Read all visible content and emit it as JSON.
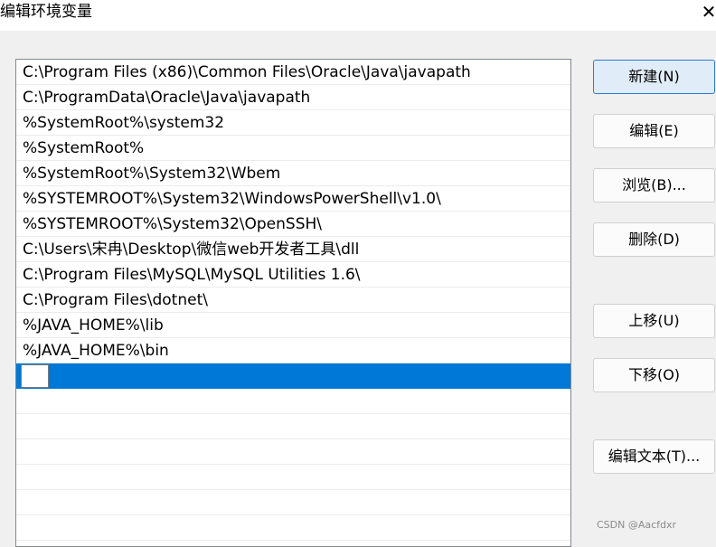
{
  "window": {
    "title": "编辑环境变量",
    "close_glyph": "✕"
  },
  "paths": [
    "C:\\Program Files (x86)\\Common Files\\Oracle\\Java\\javapath",
    "C:\\ProgramData\\Oracle\\Java\\javapath",
    "%SystemRoot%\\system32",
    "%SystemRoot%",
    "%SystemRoot%\\System32\\Wbem",
    "%SYSTEMROOT%\\System32\\WindowsPowerShell\\v1.0\\",
    "%SYSTEMROOT%\\System32\\OpenSSH\\",
    "C:\\Users\\宋冉\\Desktop\\微信web开发者工具\\dll",
    "C:\\Program Files\\MySQL\\MySQL Utilities 1.6\\",
    "C:\\Program Files\\dotnet\\",
    "%JAVA_HOME%\\lib",
    "%JAVA_HOME%\\bin"
  ],
  "new_entry": {
    "value": "",
    "selected": true
  },
  "buttons": {
    "new": "新建(N)",
    "edit": "编辑(E)",
    "browse": "浏览(B)...",
    "delete": "删除(D)",
    "move_up": "上移(U)",
    "move_down": "下移(O)",
    "edit_text": "编辑文本(T)..."
  },
  "watermark": "CSDN @Aacfdxr",
  "colors": {
    "selection": "#0078d7",
    "primary_button_border": "#2d7bd5",
    "background": "#f0f0f0"
  }
}
